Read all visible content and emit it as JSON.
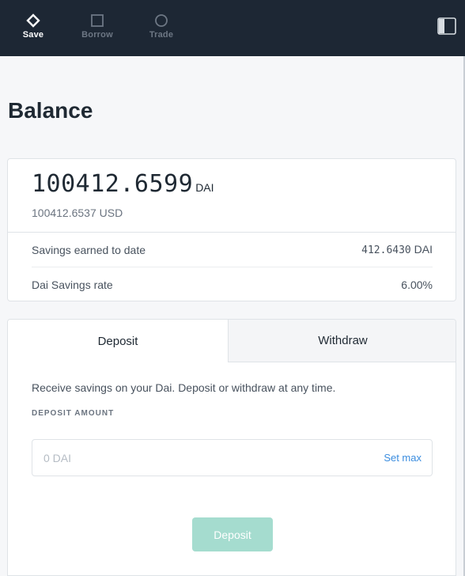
{
  "nav": {
    "items": [
      {
        "label": "Save",
        "icon": "diamond-icon",
        "active": true
      },
      {
        "label": "Borrow",
        "icon": "square-icon",
        "active": false
      },
      {
        "label": "Trade",
        "icon": "circle-icon",
        "active": false
      }
    ],
    "sidebar_toggle_icon": "sidebar-toggle-icon"
  },
  "page": {
    "title": "Balance"
  },
  "balance": {
    "amount": "100412.6599",
    "unit": "DAI",
    "usd": "100412.6537 USD",
    "stats": [
      {
        "label": "Savings earned to date",
        "value": "412.6430",
        "unit": "DAI"
      },
      {
        "label": "Dai Savings rate",
        "value": "6.00%"
      }
    ]
  },
  "actions": {
    "tabs": [
      {
        "label": "Deposit",
        "active": true
      },
      {
        "label": "Withdraw",
        "active": false
      }
    ],
    "description": "Receive savings on your Dai. Deposit or withdraw at any time.",
    "amount_label": "DEPOSIT AMOUNT",
    "amount_placeholder": "0 DAI",
    "amount_value": "",
    "set_max_label": "Set max",
    "submit_label": "Deposit"
  },
  "colors": {
    "nav_bg": "#1d2734",
    "accent": "#3b8ddf",
    "button_disabled": "#a5dccf"
  }
}
